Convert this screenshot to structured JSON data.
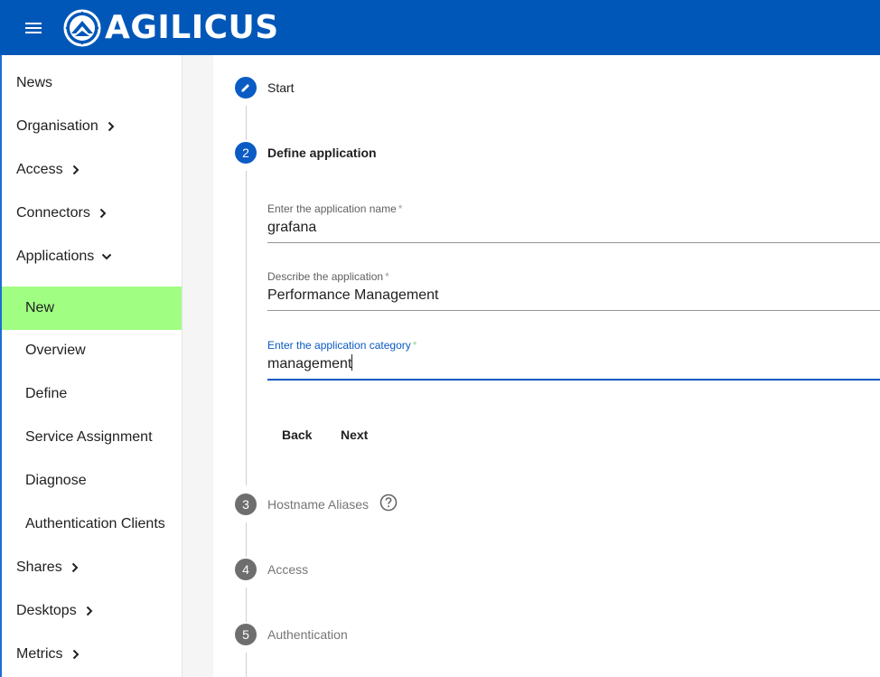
{
  "header": {
    "brand": "AGILICUS",
    "menu_icon": "hamburger-menu-icon",
    "brand_color": "#0057b8"
  },
  "sidebar": {
    "items": [
      {
        "label": "News",
        "chevron": null
      },
      {
        "label": "Organisation",
        "chevron": "right"
      },
      {
        "label": "Access",
        "chevron": "right"
      },
      {
        "label": "Connectors",
        "chevron": "right"
      },
      {
        "label": "Applications",
        "chevron": "down"
      },
      {
        "label": "New",
        "active": true
      },
      {
        "label": "Overview"
      },
      {
        "label": "Define"
      },
      {
        "label": "Service Assignment"
      },
      {
        "label": "Diagnose"
      },
      {
        "label": "Authentication Clients"
      },
      {
        "label": "Shares",
        "chevron": "right"
      },
      {
        "label": "Desktops",
        "chevron": "right"
      },
      {
        "label": "Metrics",
        "chevron": "right"
      }
    ],
    "active_color": "#a0ff82"
  },
  "stepper": {
    "steps": [
      {
        "number": "",
        "label": "Start",
        "state": "edit"
      },
      {
        "number": "2",
        "label": "Define application",
        "state": "active"
      },
      {
        "number": "3",
        "label": "Hostname Aliases",
        "state": "pending"
      },
      {
        "number": "4",
        "label": "Access",
        "state": "pending"
      },
      {
        "number": "5",
        "label": "Authentication",
        "state": "pending"
      }
    ]
  },
  "form": {
    "name": {
      "label": "Enter the application name",
      "required": "*",
      "value": "grafana"
    },
    "description": {
      "label": "Describe the application",
      "required": "*",
      "value": "Performance Management"
    },
    "category": {
      "label": "Enter the application category",
      "required": "*",
      "value": "management"
    }
  },
  "buttons": {
    "back": "Back",
    "next": "Next"
  }
}
